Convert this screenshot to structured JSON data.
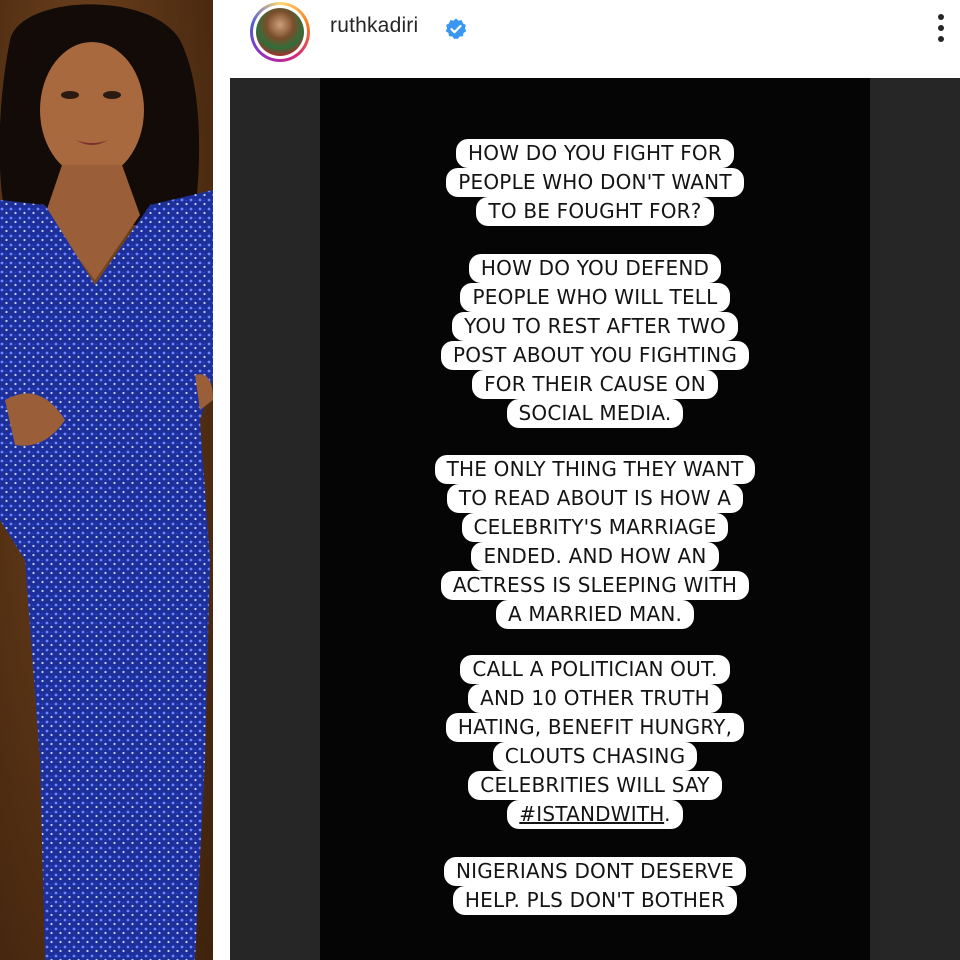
{
  "profile": {
    "username": "ruthkadiri",
    "verified_icon": "verified-badge-icon",
    "more_icon": "more-options-icon"
  },
  "colors": {
    "story_background": "#050505",
    "text_box": "#ffffff",
    "verified_blue": "#3897f0"
  },
  "story": {
    "blocks": [
      {
        "lines": [
          "HOW DO YOU FIGHT FOR",
          "PEOPLE WHO DON'T WANT",
          "TO BE FOUGHT FOR?"
        ]
      },
      {
        "lines": [
          "HOW DO YOU DEFEND",
          "PEOPLE WHO WILL TELL",
          "YOU TO REST AFTER TWO",
          "POST ABOUT YOU FIGHTING",
          "FOR THEIR CAUSE ON",
          "SOCIAL MEDIA."
        ]
      },
      {
        "lines": [
          "THE ONLY THING THEY WANT",
          "TO READ ABOUT IS HOW A",
          "CELEBRITY'S MARRIAGE",
          "ENDED. AND HOW AN",
          "ACTRESS IS SLEEPING WITH",
          "A MARRIED MAN."
        ]
      },
      {
        "lines": [
          "CALL A POLITICIAN OUT.",
          "AND 10 OTHER TRUTH",
          "HATING, BENEFIT HUNGRY,",
          "CLOUTS CHASING",
          "CELEBRITIES WILL SAY"
        ],
        "hashtag": "#ISTANDWITH",
        "hashtag_suffix": "."
      },
      {
        "lines": [
          "NIGERIANS DONT DESERVE",
          "HELP. PLS DON'T BOTHER"
        ]
      }
    ]
  }
}
